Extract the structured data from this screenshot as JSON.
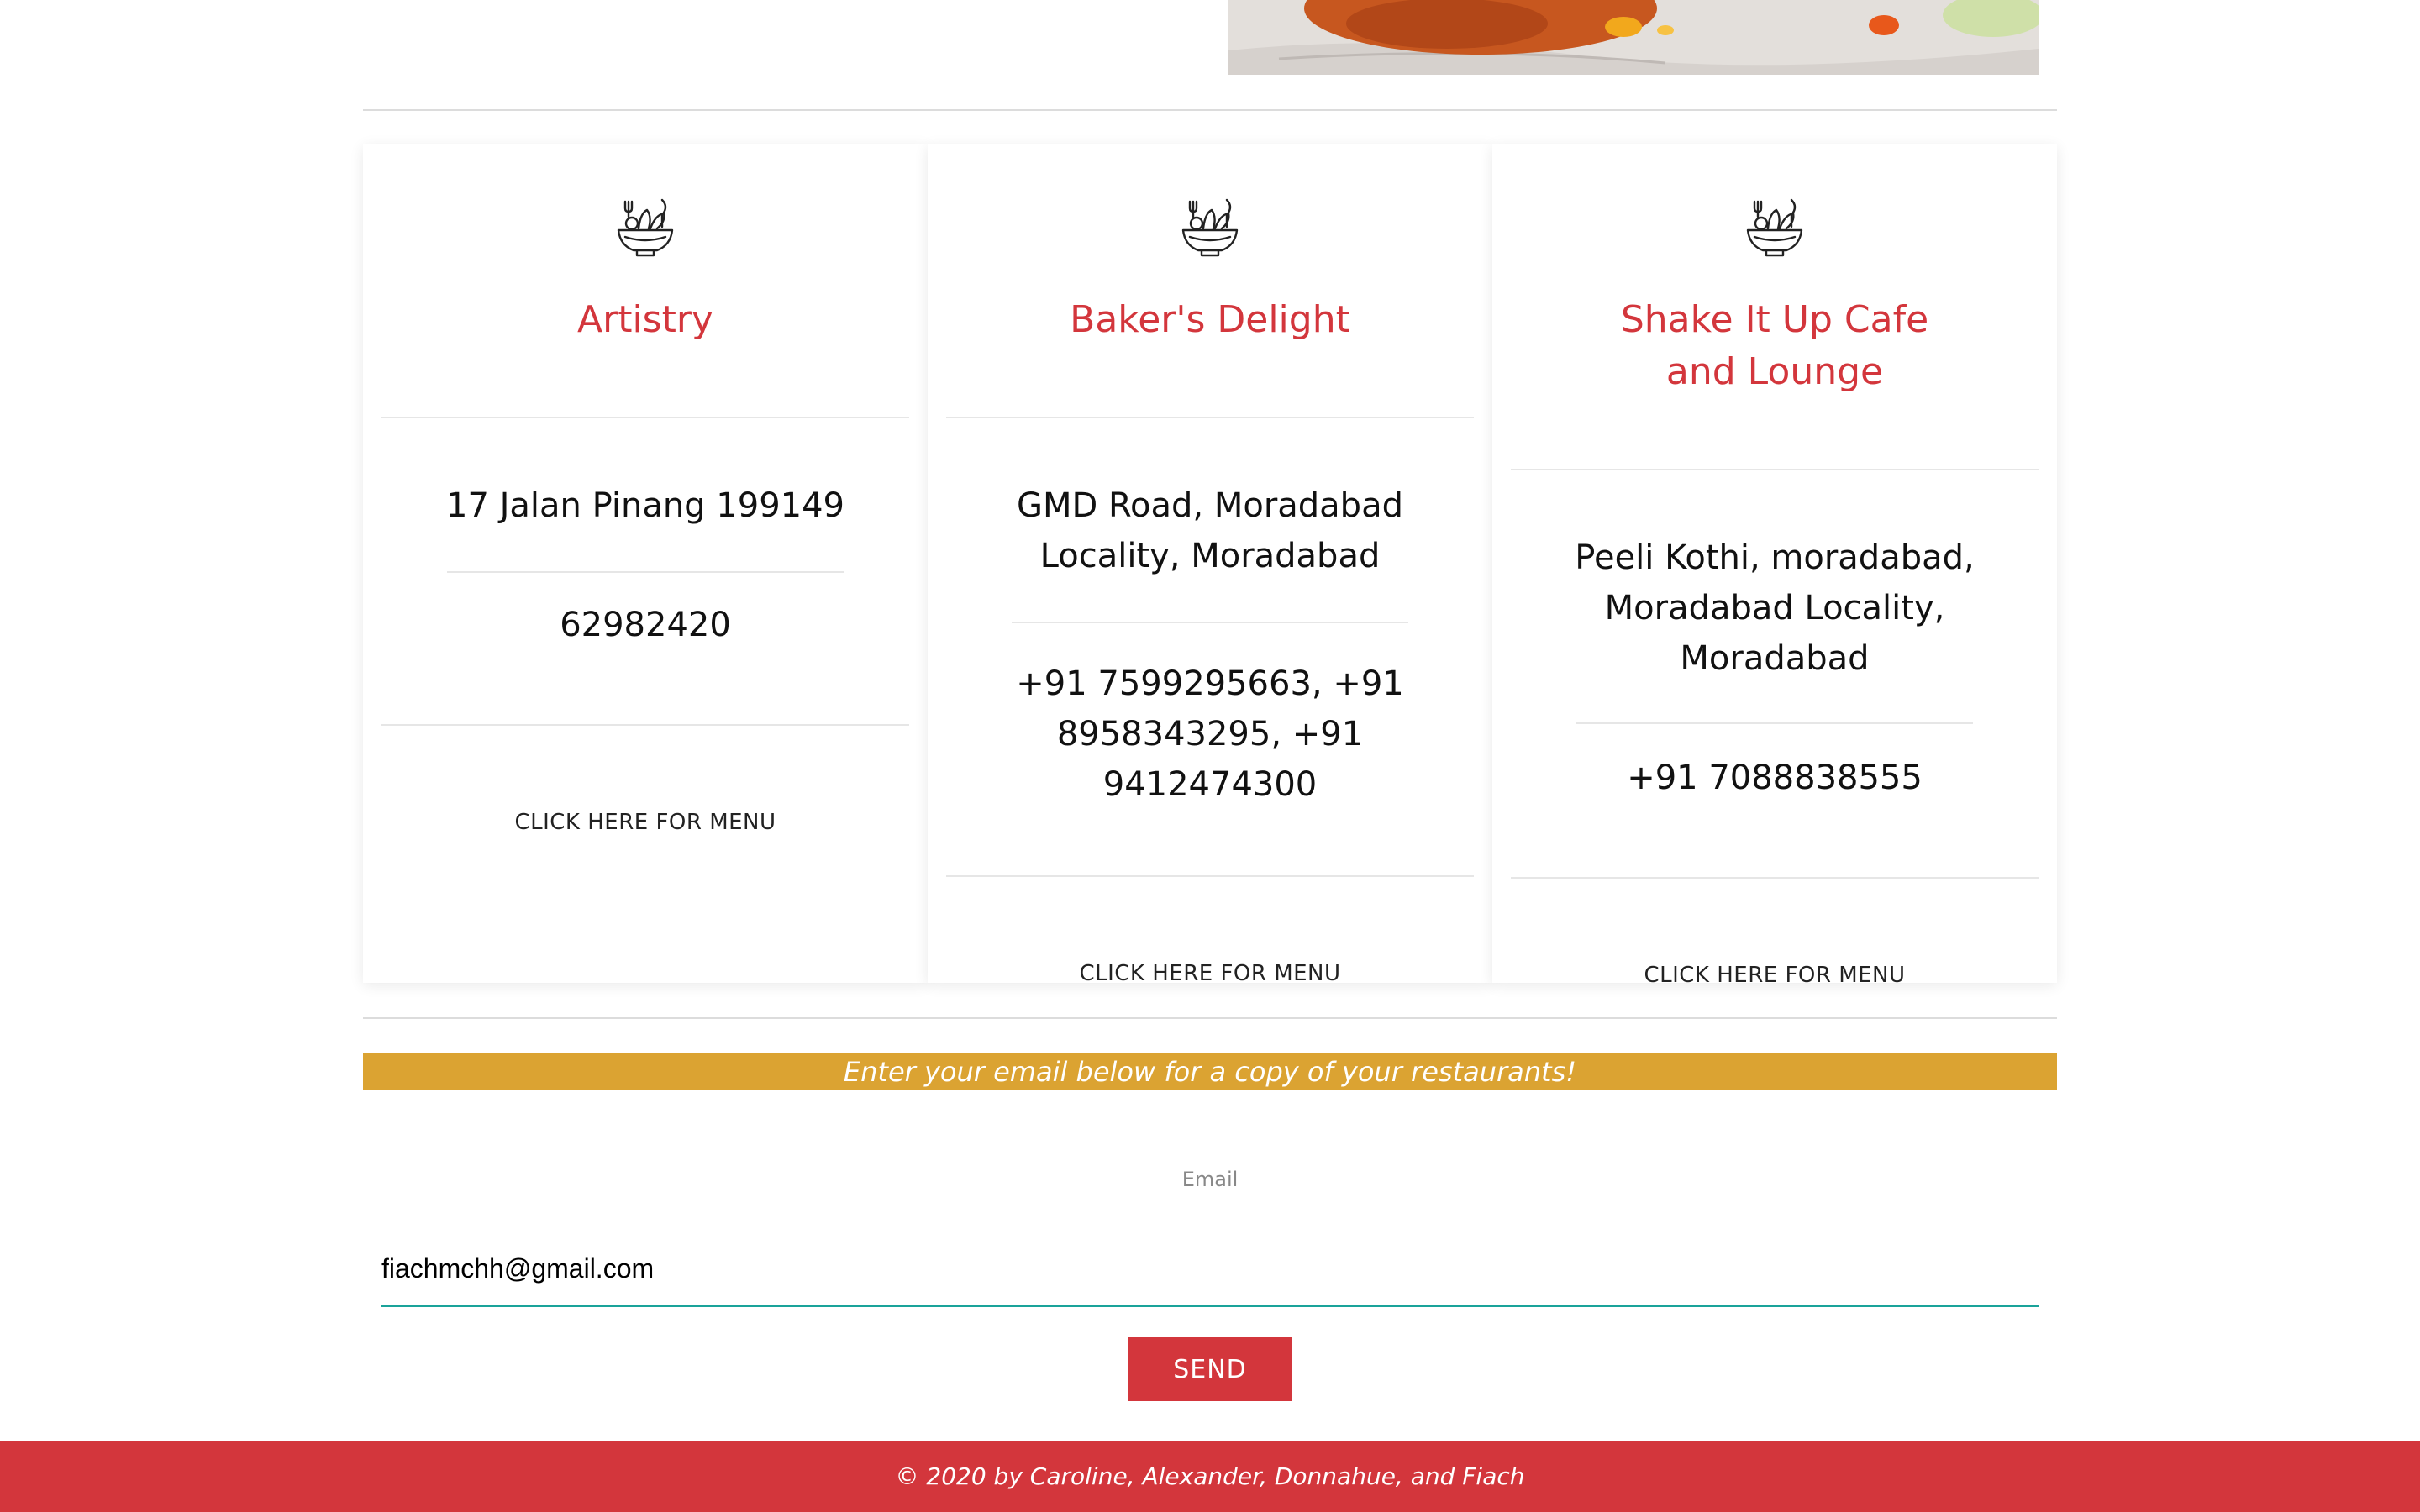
{
  "hero": {
    "alt": "food-photo"
  },
  "cards": [
    {
      "name": "Artistry",
      "address": "17 Jalan Pinang 199149",
      "phone": "62982420",
      "menu_label": "CLICK HERE FOR MENU"
    },
    {
      "name": "Baker's Delight",
      "address": "GMD Road, Moradabad\nLocality, Moradabad",
      "phone": "+91 7599295663, +91\n8958343295, +91\n9412474300",
      "menu_label": "CLICK HERE FOR MENU"
    },
    {
      "name": "Shake It Up Cafe\nand Lounge",
      "address": "Peeli Kothi, moradabad,\nMoradabad Locality,\nMoradabad",
      "phone": "+91 7088838555",
      "menu_label": "CLICK HERE FOR MENU"
    }
  ],
  "icon": "salad-bowl-icon",
  "subscribe": {
    "banner": "Enter your email below for a copy of your restaurants!",
    "email_label": "Email",
    "email_value": "fiachmchh@gmail.com",
    "send_label": "SEND"
  },
  "footer": {
    "text": "© 2020 by Caroline, Alexander, Donnahue, and Fiach"
  },
  "colors": {
    "accent_red": "#d3363c",
    "banner_gold": "#dba332",
    "input_underline": "#1aa39a"
  }
}
